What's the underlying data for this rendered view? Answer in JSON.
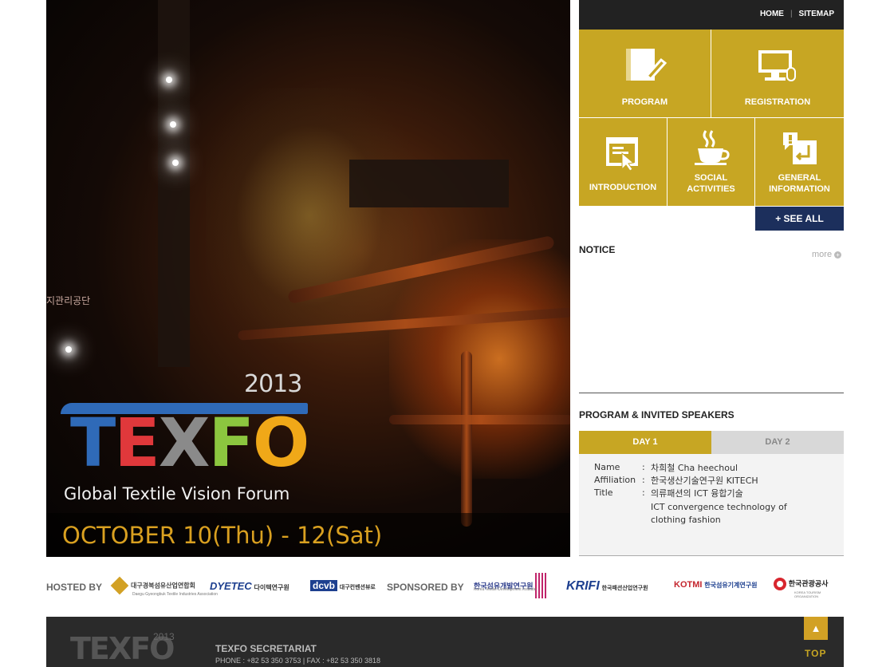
{
  "header": {
    "links": [
      "HOME",
      "SITEMAP"
    ]
  },
  "hero": {
    "sign_text": "지관리공단",
    "year": "2013",
    "logo_letters": [
      "T",
      "E",
      "X",
      "F",
      "O"
    ],
    "logo_colors": [
      "#2f6ab8",
      "#e0383b",
      "#8a8a8a",
      "#8cc63f",
      "#f0a818"
    ],
    "tagline": "Global Textile Vision Forum",
    "dates": "OCTOBER 10(Thu) - 12(Sat)"
  },
  "menu": {
    "program": "PROGRAM",
    "registration": "REGISTRATION",
    "introduction": "INTRODUCTION",
    "social_1": "SOCIAL",
    "social_2": "ACTIVITIES",
    "general_1": "GENERAL",
    "general_2": "INFORMATION",
    "see_all": "+ SEE ALL"
  },
  "notice": {
    "title": "NOTICE",
    "more": "more"
  },
  "program": {
    "title": "PROGRAM & INVITED SPEAKERS",
    "tabs": [
      "DAY 1",
      "DAY 2"
    ],
    "active_tab": "DAY 1",
    "speaker": {
      "name_label": "Name",
      "affiliation_label": "Affiliation",
      "title_label": "Title",
      "colon": ":",
      "name": "차희철 Cha heechoul",
      "affiliation": "한국생산기술연구원 KITECH",
      "title_ko": "의류패션의 ICT 융합기술",
      "title_en": "ICT convergence technology of clothing fashion"
    }
  },
  "sponsors": {
    "hosted_by": "HOSTED BY",
    "sponsored_by": "SPONSORED BY",
    "hosts": [
      {
        "name": "대구경북섬유산업연합회",
        "sub": "Daegu Gyeongbuk Textile Industries Association"
      },
      {
        "name": "DYETEC",
        "sub": "다이텍연구원"
      },
      {
        "name": "dcvb",
        "sub": "대구컨벤션뷰로"
      }
    ],
    "sponsors": [
      {
        "name": "한국섬유개발연구원",
        "sub": "Korea Textile Development Institute"
      },
      {
        "name": "KRIFI",
        "sub": "한국패션산업연구원"
      },
      {
        "name": "KOTMI",
        "sub": "한국섬유기계연구원"
      },
      {
        "name": "한국관광공사",
        "sub": "KOREA TOURISM ORGANIZATION"
      }
    ]
  },
  "footer": {
    "logo": "TEXFO",
    "year": "2013",
    "title": "TEXFO SECRETARIAT",
    "contact": "PHONE : +82 53 350 3753   |   FAX : +82 53 350 3818"
  },
  "top_button": {
    "label": "TOP"
  }
}
